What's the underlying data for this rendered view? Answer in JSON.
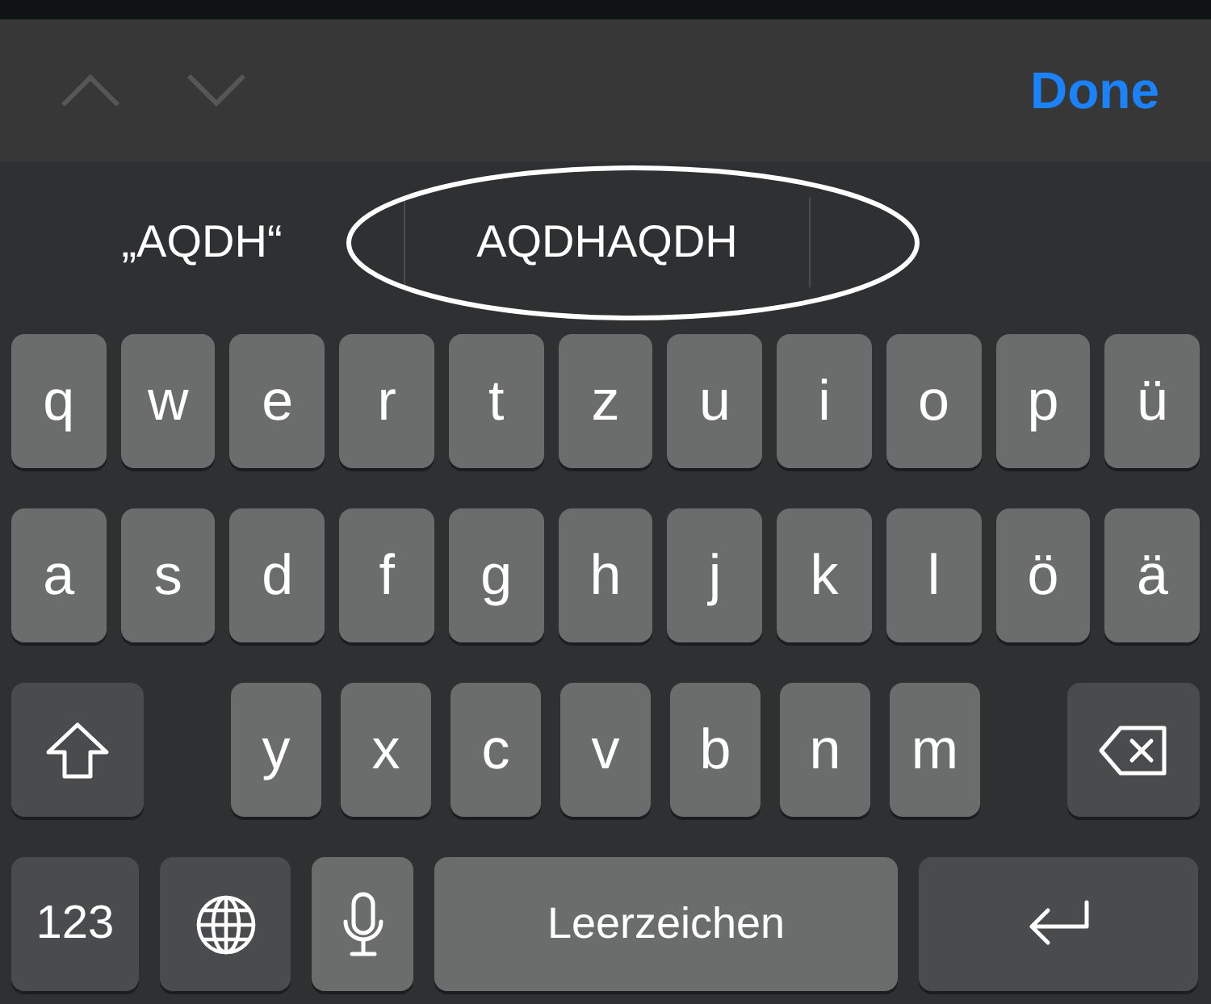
{
  "toolbar": {
    "previous": {
      "disabled": true
    },
    "next": {
      "disabled": true
    },
    "done": "Done"
  },
  "suggestions": [
    {
      "text": "„AQDH“",
      "circled": false
    },
    {
      "text": "AQDHAQDH",
      "circled": true
    }
  ],
  "keyboard": {
    "rows": [
      {
        "keys": [
          {
            "kind": "letter",
            "label": "q"
          },
          {
            "kind": "letter",
            "label": "w"
          },
          {
            "kind": "letter",
            "label": "e"
          },
          {
            "kind": "letter",
            "label": "r"
          },
          {
            "kind": "letter",
            "label": "t"
          },
          {
            "kind": "letter",
            "label": "z"
          },
          {
            "kind": "letter",
            "label": "u"
          },
          {
            "kind": "letter",
            "label": "i"
          },
          {
            "kind": "letter",
            "label": "o"
          },
          {
            "kind": "letter",
            "label": "p"
          },
          {
            "kind": "letter",
            "label": "ü"
          }
        ]
      },
      {
        "keys": [
          {
            "kind": "letter",
            "label": "a"
          },
          {
            "kind": "letter",
            "label": "s"
          },
          {
            "kind": "letter",
            "label": "d"
          },
          {
            "kind": "letter",
            "label": "f"
          },
          {
            "kind": "letter",
            "label": "g"
          },
          {
            "kind": "letter",
            "label": "h"
          },
          {
            "kind": "letter",
            "label": "j"
          },
          {
            "kind": "letter",
            "label": "k"
          },
          {
            "kind": "letter",
            "label": "l"
          },
          {
            "kind": "letter",
            "label": "ö"
          },
          {
            "kind": "letter",
            "label": "ä"
          }
        ]
      },
      {
        "keys": [
          {
            "kind": "shift"
          },
          {
            "kind": "letter",
            "label": "y"
          },
          {
            "kind": "letter",
            "label": "x"
          },
          {
            "kind": "letter",
            "label": "c"
          },
          {
            "kind": "letter",
            "label": "v"
          },
          {
            "kind": "letter",
            "label": "b"
          },
          {
            "kind": "letter",
            "label": "n"
          },
          {
            "kind": "letter",
            "label": "m"
          },
          {
            "kind": "delete"
          }
        ]
      },
      {
        "keys": [
          {
            "kind": "numbers",
            "label": "123"
          },
          {
            "kind": "globe"
          },
          {
            "kind": "mic"
          },
          {
            "kind": "space",
            "label": "Leerzeichen"
          },
          {
            "kind": "return"
          }
        ]
      }
    ]
  }
}
